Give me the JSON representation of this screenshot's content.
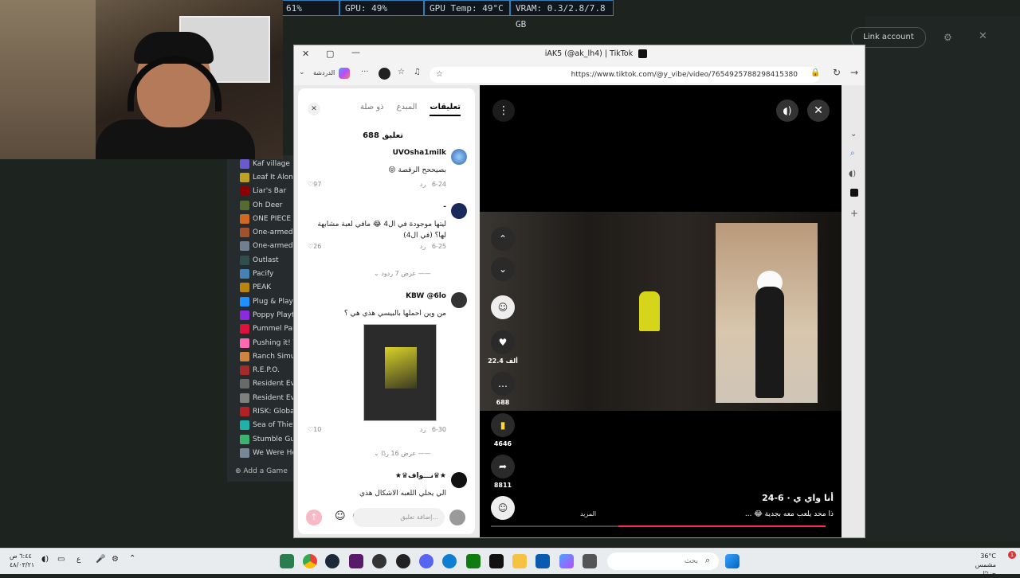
{
  "stats": [
    "61%",
    "GPU: 49%",
    "GPU Temp: 49°C",
    "VRAM: 0.3/2.8/7.8 GB"
  ],
  "background_app": {
    "link_account": "Link account",
    "games": [
      "Kaf village",
      "Leaf It Alone",
      "Liar's Bar",
      "Oh Deer",
      "ONE PIECE O",
      "One-armed",
      "One-armed",
      "Outlast",
      "Pacify",
      "PEAK",
      "Plug & Play",
      "Poppy Playti",
      "Pummel Part",
      "Pushing it! T",
      "Ranch Simul",
      "R.E.P.O.",
      "Resident Evi",
      "Resident Evi",
      "RISK: Global",
      "Sea of Thiev",
      "Stumble Guy",
      "We Were He"
    ],
    "add_game": "Add a Game"
  },
  "browser": {
    "title": "iAK5 (@ak_lh4) | TikTok",
    "url": "https://www.tiktok.com/@y_vibe/video/7654925788298415380",
    "chat_label": "الدردشة"
  },
  "comments": {
    "tabs": [
      "تعليقات",
      "المبدع",
      "ذو صلة"
    ],
    "count": "688 تعليق",
    "items": [
      {
        "user": "UVOsha1milk",
        "text": "بصيححح الرقصة 😝",
        "date": "6-24",
        "reply": "رد",
        "likes": "97"
      },
      {
        "user": "-",
        "text": "ليتها موجودة في ال4 😂 مافي لعبة مشابهة لها؟ (في ال4)",
        "date": "6-25",
        "reply": "رد",
        "likes": "26"
      },
      {
        "user": "KBW @6lo",
        "text": "من وين احملها بالبيسي هذي هي ؟",
        "date": "6-30",
        "reply": "رد",
        "likes": "10"
      },
      {
        "user": "★♛نـــواف♛★",
        "text": "الي يحلي اللعبه الاشكال هذي"
      }
    ],
    "view_replies_1": "عرض 7 ردود",
    "view_replies_2": "عرض 16 ردًا",
    "input_placeholder": "إضافة تعليق..."
  },
  "video": {
    "likes": "22.4 ألف",
    "comments": "688",
    "saves": "4646",
    "shares": "8811",
    "author": "أنا واي ي · 6-24",
    "description": "ذا محد يلعب معه بجدية 😂 ...",
    "more": "المزيد",
    "progress": 0.62
  },
  "taskbar": {
    "search_placeholder": "بحث",
    "time": "٦:٤٤ ص",
    "date": "٤٨/٠٣/٢١",
    "weather_temp": "36°C",
    "weather_desc": "مشمس جزئيًا",
    "lang": "ع"
  }
}
